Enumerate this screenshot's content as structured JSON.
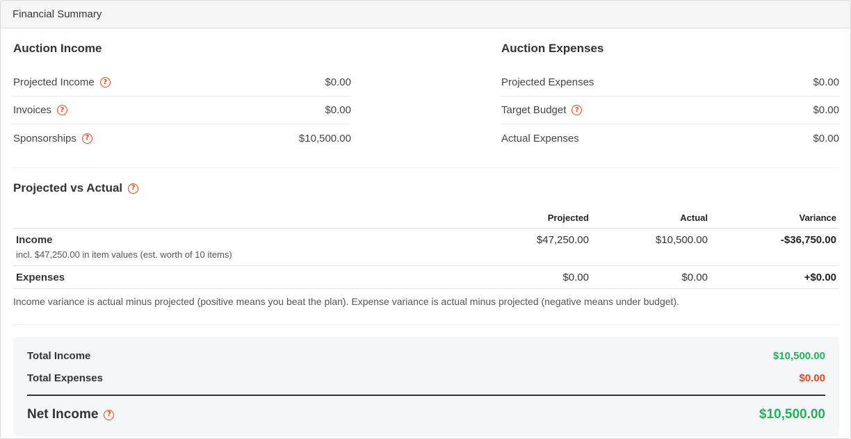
{
  "header": {
    "title": "Financial Summary"
  },
  "auction_income": {
    "title": "Auction Income",
    "rows": [
      {
        "label": "Projected Income",
        "value": "$0.00",
        "help": "?"
      },
      {
        "label": "Invoices",
        "value": "$0.00",
        "help": "?"
      },
      {
        "label": "Sponsorships",
        "value": "$10,500.00",
        "help": "?"
      }
    ]
  },
  "auction_expenses": {
    "title": "Auction Expenses",
    "rows": [
      {
        "label": "Projected Expenses",
        "value": "$0.00"
      },
      {
        "label": "Target Budget",
        "value": "$0.00",
        "help": "?"
      },
      {
        "label": "Actual Expenses",
        "value": "$0.00"
      }
    ]
  },
  "projected_vs_actual": {
    "title": "Projected vs Actual",
    "help": "?",
    "columns": [
      "",
      "Projected",
      "Actual",
      "Variance"
    ],
    "rows": [
      {
        "label": "Income",
        "sub": "incl. $47,250.00 in item values (est. worth of 10 items)",
        "projected": "$47,250.00",
        "actual": "$10,500.00",
        "variance": "-$36,750.00"
      },
      {
        "label": "Expenses",
        "projected": "$0.00",
        "actual": "$0.00",
        "variance": "+$0.00"
      }
    ],
    "note": "Income variance is actual minus projected (positive means you beat the plan). Expense variance is actual minus projected (negative means under budget)."
  },
  "totals": {
    "income_label": "Total Income",
    "income_value": "$10,500.00",
    "expenses_label": "Total Expenses",
    "expenses_value": "$0.00",
    "net_label": "Net Income",
    "net_help": "?",
    "net_value": "$10,500.00"
  },
  "colors": {
    "accent_help": "#e8481d",
    "positive": "#21b35a",
    "negative": "#e8481d"
  },
  "icons": {
    "help": "question-circle-icon"
  }
}
